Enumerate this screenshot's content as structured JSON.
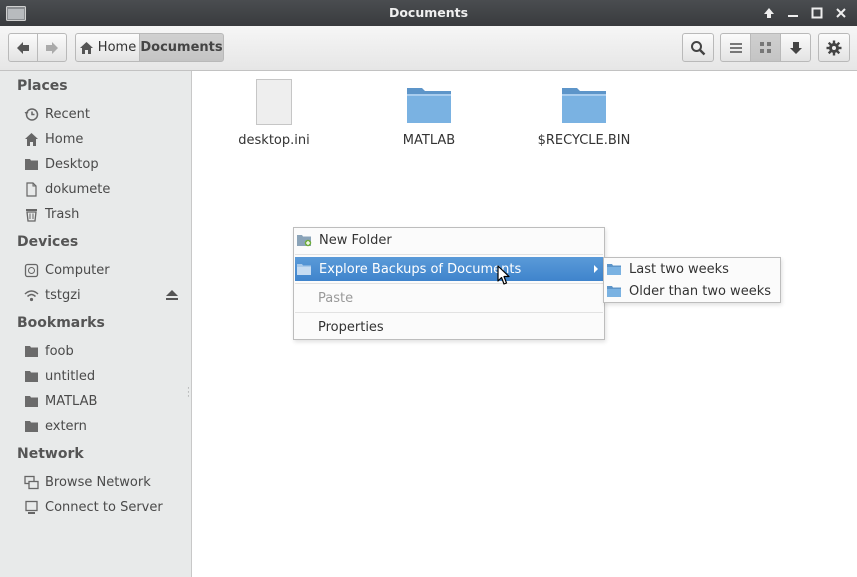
{
  "window": {
    "title": "Documents"
  },
  "toolbar": {
    "home_label": "Home",
    "current_label": "Documents"
  },
  "sidebar": {
    "places_heading": "Places",
    "places": [
      {
        "label": "Recent",
        "icon": "clock-icon"
      },
      {
        "label": "Home",
        "icon": "home-icon"
      },
      {
        "label": "Desktop",
        "icon": "folder-icon"
      },
      {
        "label": "dokumete",
        "icon": "file-icon"
      },
      {
        "label": "Trash",
        "icon": "trash-icon"
      }
    ],
    "devices_heading": "Devices",
    "devices": [
      {
        "label": "Computer",
        "icon": "drive-icon"
      },
      {
        "label": "tstgzi",
        "icon": "wifi-icon"
      }
    ],
    "bookmarks_heading": "Bookmarks",
    "bookmarks": [
      {
        "label": "foob",
        "icon": "folder-icon"
      },
      {
        "label": "untitled",
        "icon": "folder-icon"
      },
      {
        "label": "MATLAB",
        "icon": "folder-icon"
      },
      {
        "label": "extern",
        "icon": "folder-icon"
      }
    ],
    "network_heading": "Network",
    "network": [
      {
        "label": "Browse Network",
        "icon": "network-icon"
      },
      {
        "label": "Connect to Server",
        "icon": "server-icon"
      }
    ]
  },
  "files": [
    {
      "name": "desktop.ini",
      "type": "file"
    },
    {
      "name": "MATLAB",
      "type": "folder"
    },
    {
      "name": "$RECYCLE.BIN",
      "type": "folder"
    }
  ],
  "context_menu": {
    "items": [
      {
        "label": "New Folder",
        "state": "normal"
      },
      {
        "label": "Explore Backups of Documents",
        "state": "highlighted"
      },
      {
        "label": "Paste",
        "state": "disabled"
      },
      {
        "label": "Properties",
        "state": "normal"
      }
    ]
  },
  "submenu": {
    "items": [
      {
        "label": "Last two weeks"
      },
      {
        "label": "Older than two weeks"
      }
    ]
  },
  "colors": {
    "titlebar": "#3e4043",
    "highlight": "#4a8fd3",
    "folder_blue": "#6aa6da",
    "sidebar_bg": "#e8eaea"
  }
}
